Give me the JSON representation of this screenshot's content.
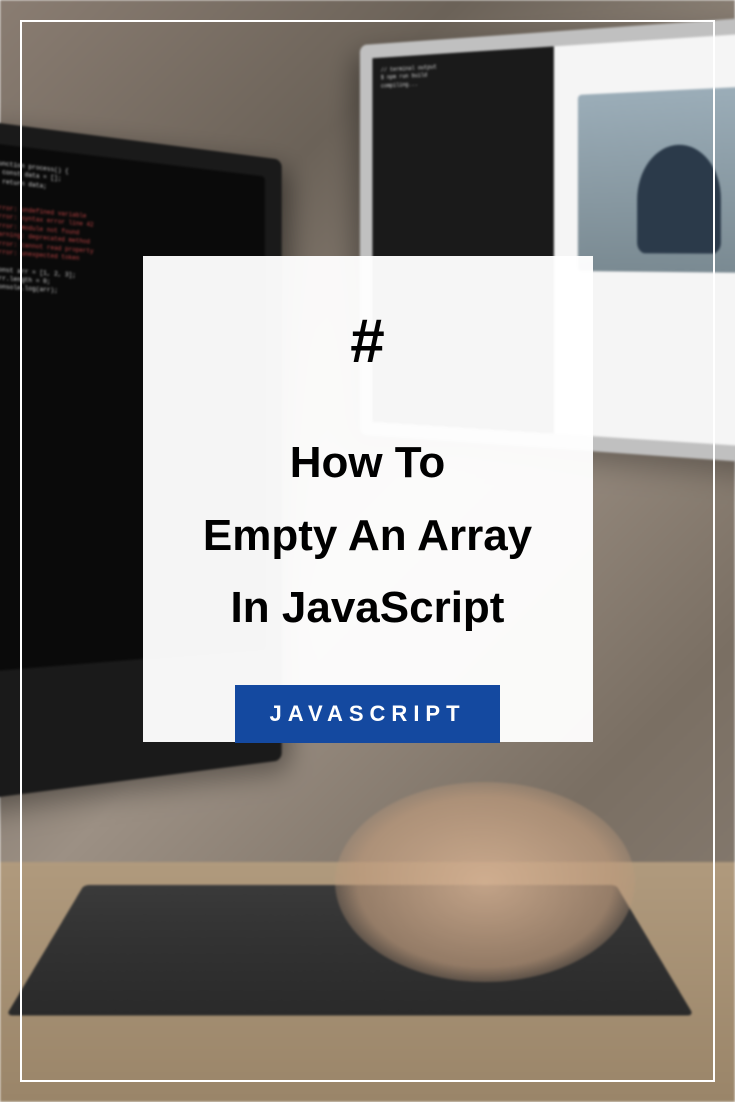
{
  "card": {
    "symbol": "#",
    "title_line1": "How To",
    "title_line2": "Empty An Array",
    "title_line3": "In JavaScript",
    "badge": "JAVASCRIPT"
  }
}
